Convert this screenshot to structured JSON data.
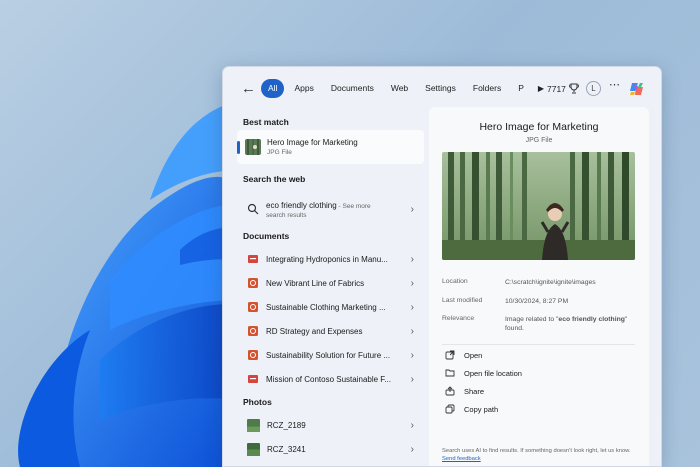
{
  "search": {
    "tabs": [
      "All",
      "Apps",
      "Documents",
      "Web",
      "Settings",
      "Folders",
      "P"
    ],
    "points": "7717",
    "avatar_letter": "L"
  },
  "left": {
    "best_match_heading": "Best match",
    "best_match": {
      "title": "Hero Image for Marketing",
      "subtitle": "JPG File"
    },
    "web_heading": "Search the web",
    "web_result": {
      "query": "eco friendly clothing",
      "see_more": " - See more",
      "subtitle": "search results"
    },
    "documents_heading": "Documents",
    "documents": [
      {
        "label": "Integrating Hydroponics in Manu...",
        "icon": "pdf-icon"
      },
      {
        "label": "New Vibrant Line of Fabrics",
        "icon": "powerpoint-icon"
      },
      {
        "label": "Sustainable Clothing Marketing ...",
        "icon": "powerpoint-icon"
      },
      {
        "label": "RD Strategy and Expenses",
        "icon": "powerpoint-icon"
      },
      {
        "label": "Sustainability Solution for Future ...",
        "icon": "powerpoint-icon"
      },
      {
        "label": "Mission of Contoso Sustainable F...",
        "icon": "pdf-icon"
      }
    ],
    "photos_heading": "Photos",
    "photos": [
      {
        "label": "RCZ_2189"
      },
      {
        "label": "RCZ_3241"
      }
    ]
  },
  "preview": {
    "title": "Hero Image for Marketing",
    "subtitle": "JPG File",
    "location_label": "Location",
    "location_value": "C:\\scratch\\ignite\\ignite\\images",
    "modified_label": "Last modified",
    "modified_value": "10/30/2024, 8:27 PM",
    "relevance_label": "Relevance",
    "relevance_prefix": "Image related to \"",
    "relevance_term": "eco friendly clothing",
    "relevance_suffix": "\" found.",
    "actions": [
      "Open",
      "Open file location",
      "Share",
      "Copy path"
    ],
    "footnote": "Search uses AI to find results. If something doesn't look right, let us know.",
    "feedback_link": "Send feedback"
  },
  "colors": {
    "accent": "#1f63c8",
    "panel": "#eef1f7",
    "preview": "#f8f9fb"
  }
}
